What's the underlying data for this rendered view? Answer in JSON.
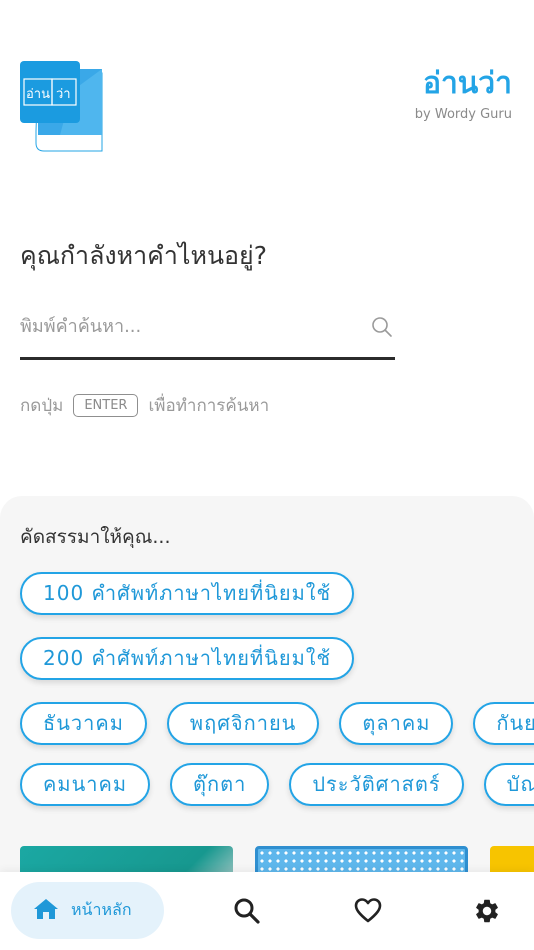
{
  "header": {
    "logo_text_left": "อ่าน",
    "logo_text_right": "ว่า",
    "title": "อ่านว่า",
    "subtitle": "by Wordy Guru"
  },
  "search": {
    "question": "คุณกำลังหาคำไหนอยู่?",
    "placeholder": "พิมพ์คำค้นหา...",
    "value": "",
    "hint_before": "กดปุ่ม",
    "hint_key": "ENTER",
    "hint_after": "เพื่อทำการค้นหา"
  },
  "suggestions": {
    "title": "คัดสรรมาให้คุณ...",
    "row1": [
      "100 คำศัพท์ภาษาไทยที่นิยมใช้"
    ],
    "row2": [
      "200 คำศัพท์ภาษาไทยที่นิยมใช้"
    ],
    "row3": [
      "ธันวาคม",
      "พฤศจิกายน",
      "ตุลาคม",
      "กันยายน"
    ],
    "row4": [
      "คมนาคม",
      "ตุ๊กตา",
      "ประวัติศาสตร์",
      "บัณฑิต"
    ]
  },
  "nav": {
    "home_label": "หน้าหลัก",
    "items": [
      "home-icon",
      "search-icon",
      "heart-icon",
      "gear-icon"
    ]
  },
  "colors": {
    "accent": "#23a4e6",
    "nav_active_bg": "#e4f2fb",
    "panel_bg": "#f6f6f6"
  }
}
